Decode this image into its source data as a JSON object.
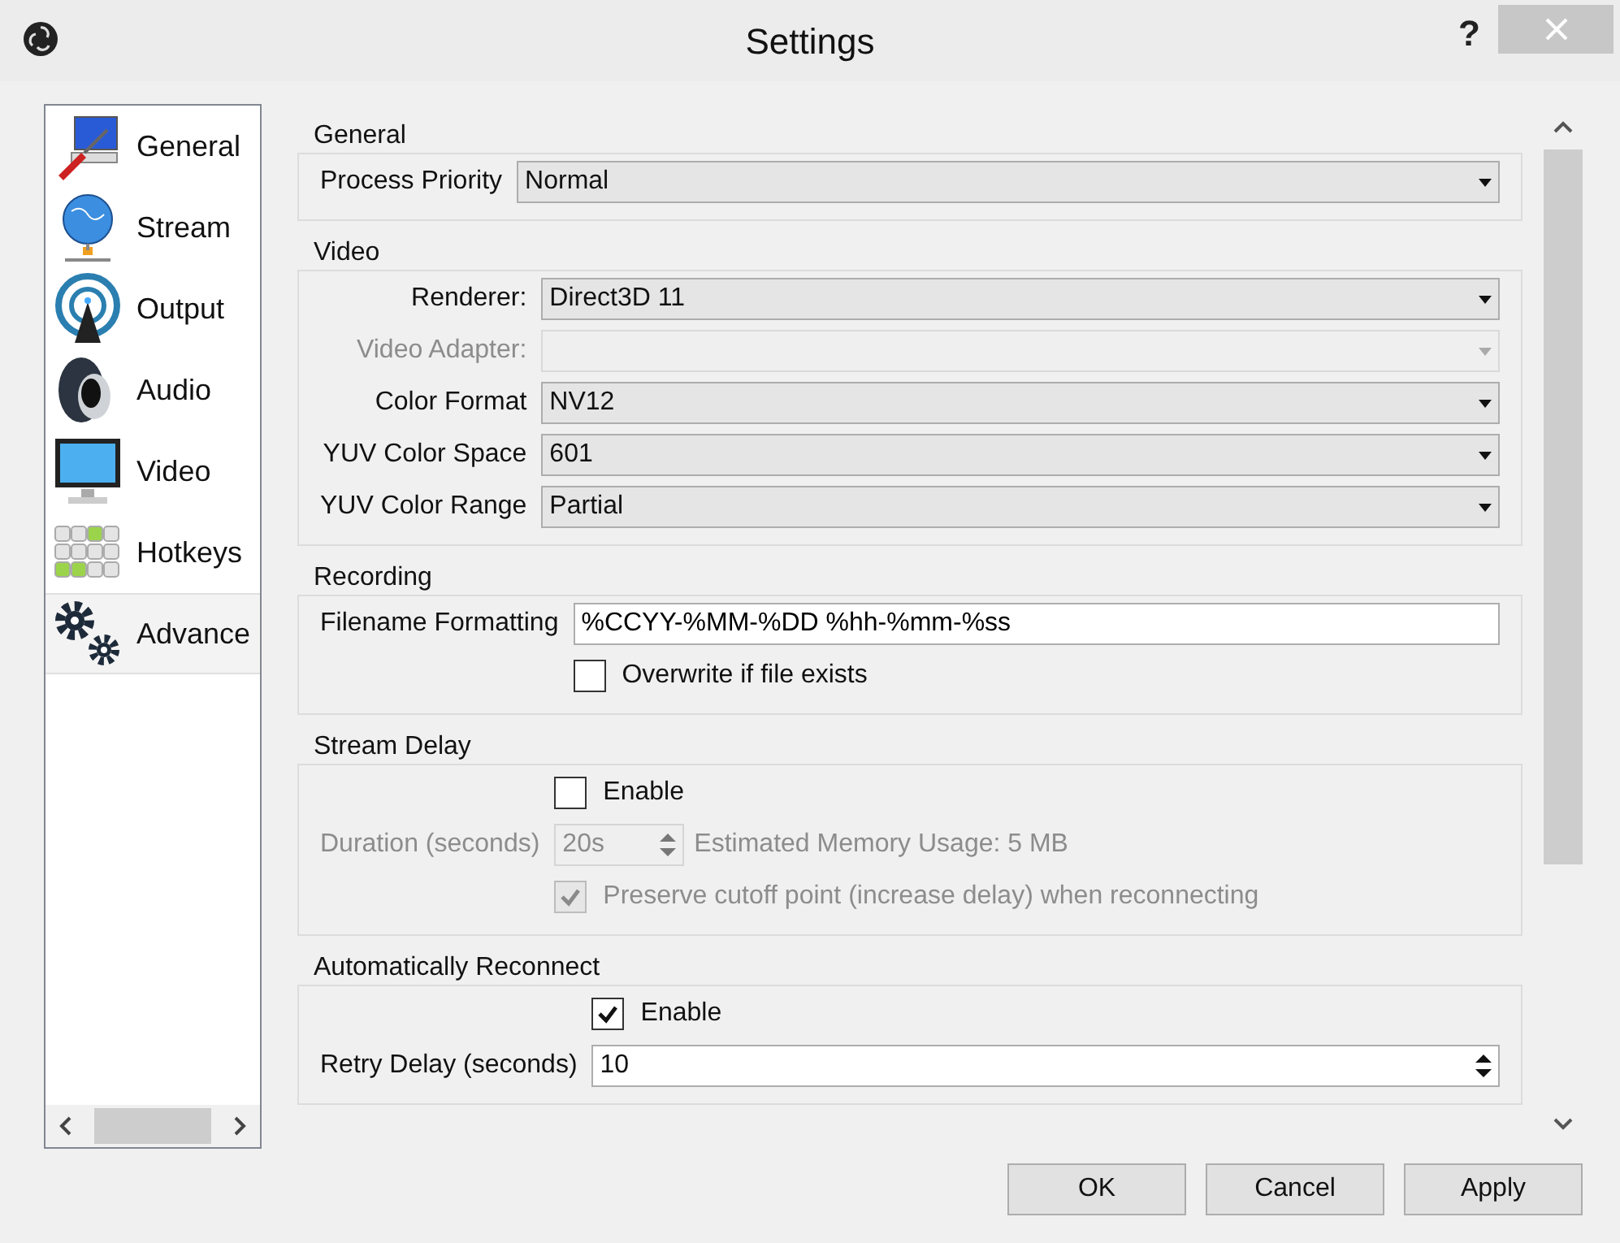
{
  "window": {
    "title": "Settings",
    "help": "?"
  },
  "sidebar": {
    "items": [
      {
        "label": "General",
        "selected": false
      },
      {
        "label": "Stream",
        "selected": false
      },
      {
        "label": "Output",
        "selected": false
      },
      {
        "label": "Audio",
        "selected": false
      },
      {
        "label": "Video",
        "selected": false
      },
      {
        "label": "Hotkeys",
        "selected": false
      },
      {
        "label": "Advance",
        "selected": true
      }
    ]
  },
  "sections": [
    {
      "title": "General",
      "rows": [
        {
          "kind": "select",
          "label": "Process Priority",
          "value": "Normal",
          "disabled": false
        }
      ]
    },
    {
      "title": "Video",
      "rows": [
        {
          "kind": "select",
          "label": "Renderer:",
          "value": "Direct3D 11",
          "disabled": false
        },
        {
          "kind": "select",
          "label": "Video Adapter:",
          "disabled": true
        },
        {
          "kind": "select",
          "label": "Color Format",
          "value": "NV12",
          "disabled": false
        },
        {
          "kind": "select",
          "label": "YUV Color Space",
          "value": "601",
          "disabled": false
        },
        {
          "kind": "select",
          "label": "YUV Color Range",
          "value": "Partial",
          "disabled": false
        }
      ]
    },
    {
      "title": "Recording",
      "rows": [
        {
          "kind": "text",
          "label": "Filename Formatting",
          "value": "%CCYY-%MM-%DD %hh-%mm-%ss",
          "disabled": false
        },
        {
          "kind": "checkbox",
          "label": "Overwrite if file exists",
          "checked": false,
          "disabled": false
        }
      ]
    },
    {
      "title": "Stream Delay",
      "rows": [
        {
          "kind": "checkbox",
          "label": "Enable",
          "checked": false,
          "disabled": false
        },
        {
          "kind": "spin",
          "label": "Duration (seconds)",
          "value": "20s",
          "note": "Estimated Memory Usage: 5 MB",
          "disabled": true
        },
        {
          "kind": "checkbox",
          "label": "Preserve cutoff point (increase delay) when reconnecting",
          "checked": true,
          "disabled": true
        }
      ]
    },
    {
      "title": "Automatically Reconnect",
      "rows": [
        {
          "kind": "checkbox",
          "label": "Enable",
          "checked": true,
          "disabled": false
        },
        {
          "kind": "spin",
          "label": "Retry Delay (seconds)",
          "value": "10",
          "disabled": false
        }
      ]
    }
  ],
  "buttons": [
    "OK",
    "Cancel",
    "Apply"
  ]
}
